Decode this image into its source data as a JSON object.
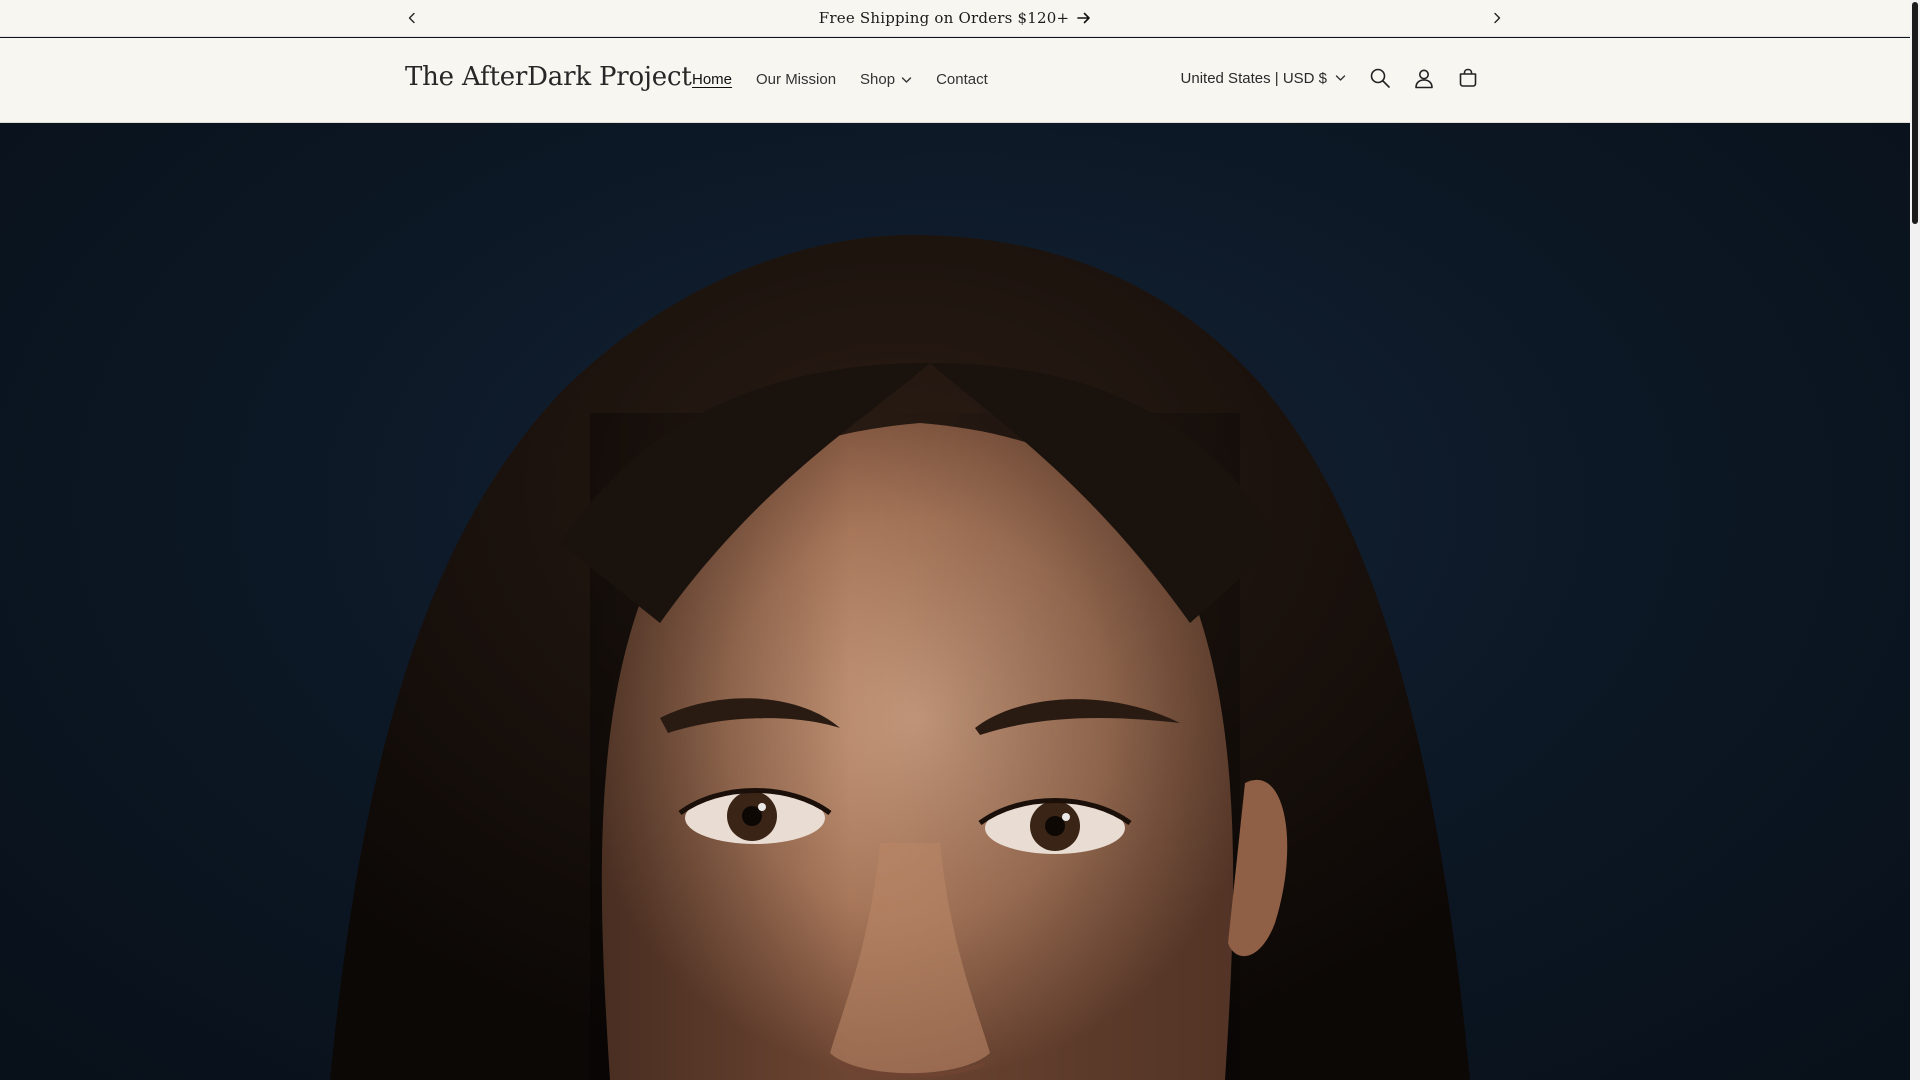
{
  "announcement": {
    "message": "Free Shipping on Orders $120+",
    "prev_icon": "chevron-left-icon",
    "next_icon": "chevron-right-icon",
    "arrow_icon": "arrow-right-icon"
  },
  "header": {
    "brand": "The AfterDark Project",
    "nav": [
      {
        "label": "Home",
        "active": true
      },
      {
        "label": "Our Mission",
        "active": false
      },
      {
        "label": "Shop",
        "active": false,
        "has_dropdown": true
      },
      {
        "label": "Contact",
        "active": false
      }
    ],
    "currency_selector": "United States | USD $",
    "icons": [
      "search-icon",
      "account-icon",
      "cart-icon"
    ]
  },
  "hero": {
    "image": "portrait-photo"
  },
  "colors": {
    "header_bg": "#f8f6f1",
    "text": "#1c1c1c",
    "hero_bg": "#0c1724"
  }
}
